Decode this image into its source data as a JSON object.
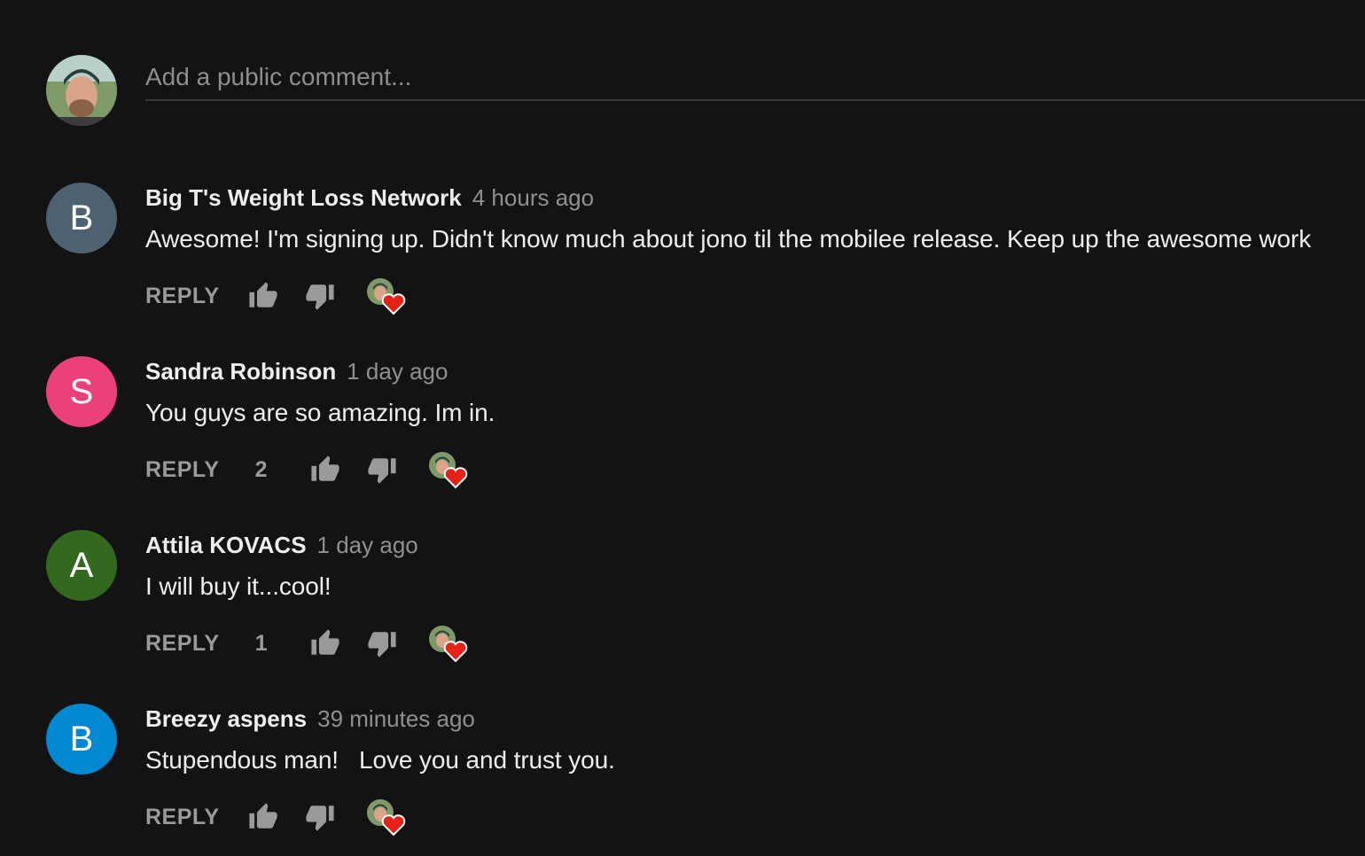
{
  "composer": {
    "placeholder": "Add a public comment..."
  },
  "actions": {
    "reply_label": "REPLY"
  },
  "colors": {
    "background": "#131313",
    "like_icon": "#9a9a9a",
    "heart": "#e62117"
  },
  "comments": [
    {
      "avatar_letter": "B",
      "avatar_color": "#4e6170",
      "author": "Big T's Weight Loss Network",
      "time": "4 hours ago",
      "text": "Awesome! I'm signing up. Didn't know much about jono til the mobilee release. Keep up the awesome work",
      "like_count": "",
      "hearted": true
    },
    {
      "avatar_letter": "S",
      "avatar_color": "#ec407a",
      "author": "Sandra Robinson",
      "time": "1 day ago",
      "text": "You guys are so amazing. Im in.",
      "like_count": "2",
      "hearted": true
    },
    {
      "avatar_letter": "A",
      "avatar_color": "#33691e",
      "author": "Attila KOVACS",
      "time": "1 day ago",
      "text": "I will buy it...cool!",
      "like_count": "1",
      "hearted": true
    },
    {
      "avatar_letter": "B",
      "avatar_color": "#0288d1",
      "author": "Breezy aspens",
      "time": "39 minutes ago",
      "text": "Stupendous man!   Love you and trust you.",
      "like_count": "",
      "hearted": true
    }
  ]
}
